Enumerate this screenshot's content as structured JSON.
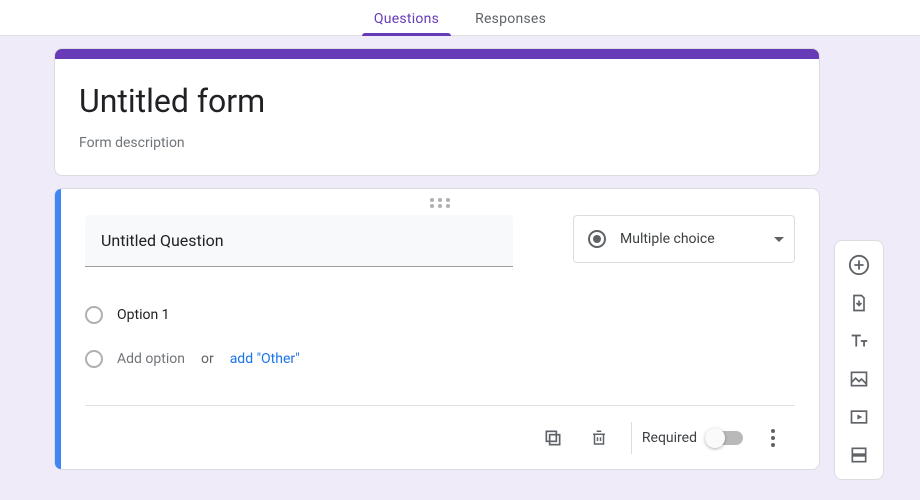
{
  "colors": {
    "accent": "#673ab7",
    "selection": "#4285f4",
    "link": "#1a73e8"
  },
  "tabs": {
    "questions": "Questions",
    "responses": "Responses",
    "active": "questions"
  },
  "header": {
    "title": "Untitled form",
    "description_placeholder": "Form description"
  },
  "question": {
    "title": "Untitled Question",
    "type_label": "Multiple choice",
    "options": [
      {
        "label": "Option 1"
      }
    ],
    "add_option_placeholder": "Add option",
    "or_text": "or",
    "add_other_label": "add \"Other\"",
    "footer": {
      "required_label": "Required",
      "required": false
    }
  },
  "side_toolbar": {
    "add_question": "add-question",
    "import_questions": "import-questions",
    "add_title": "add-title-description",
    "add_image": "add-image",
    "add_video": "add-video",
    "add_section": "add-section"
  }
}
